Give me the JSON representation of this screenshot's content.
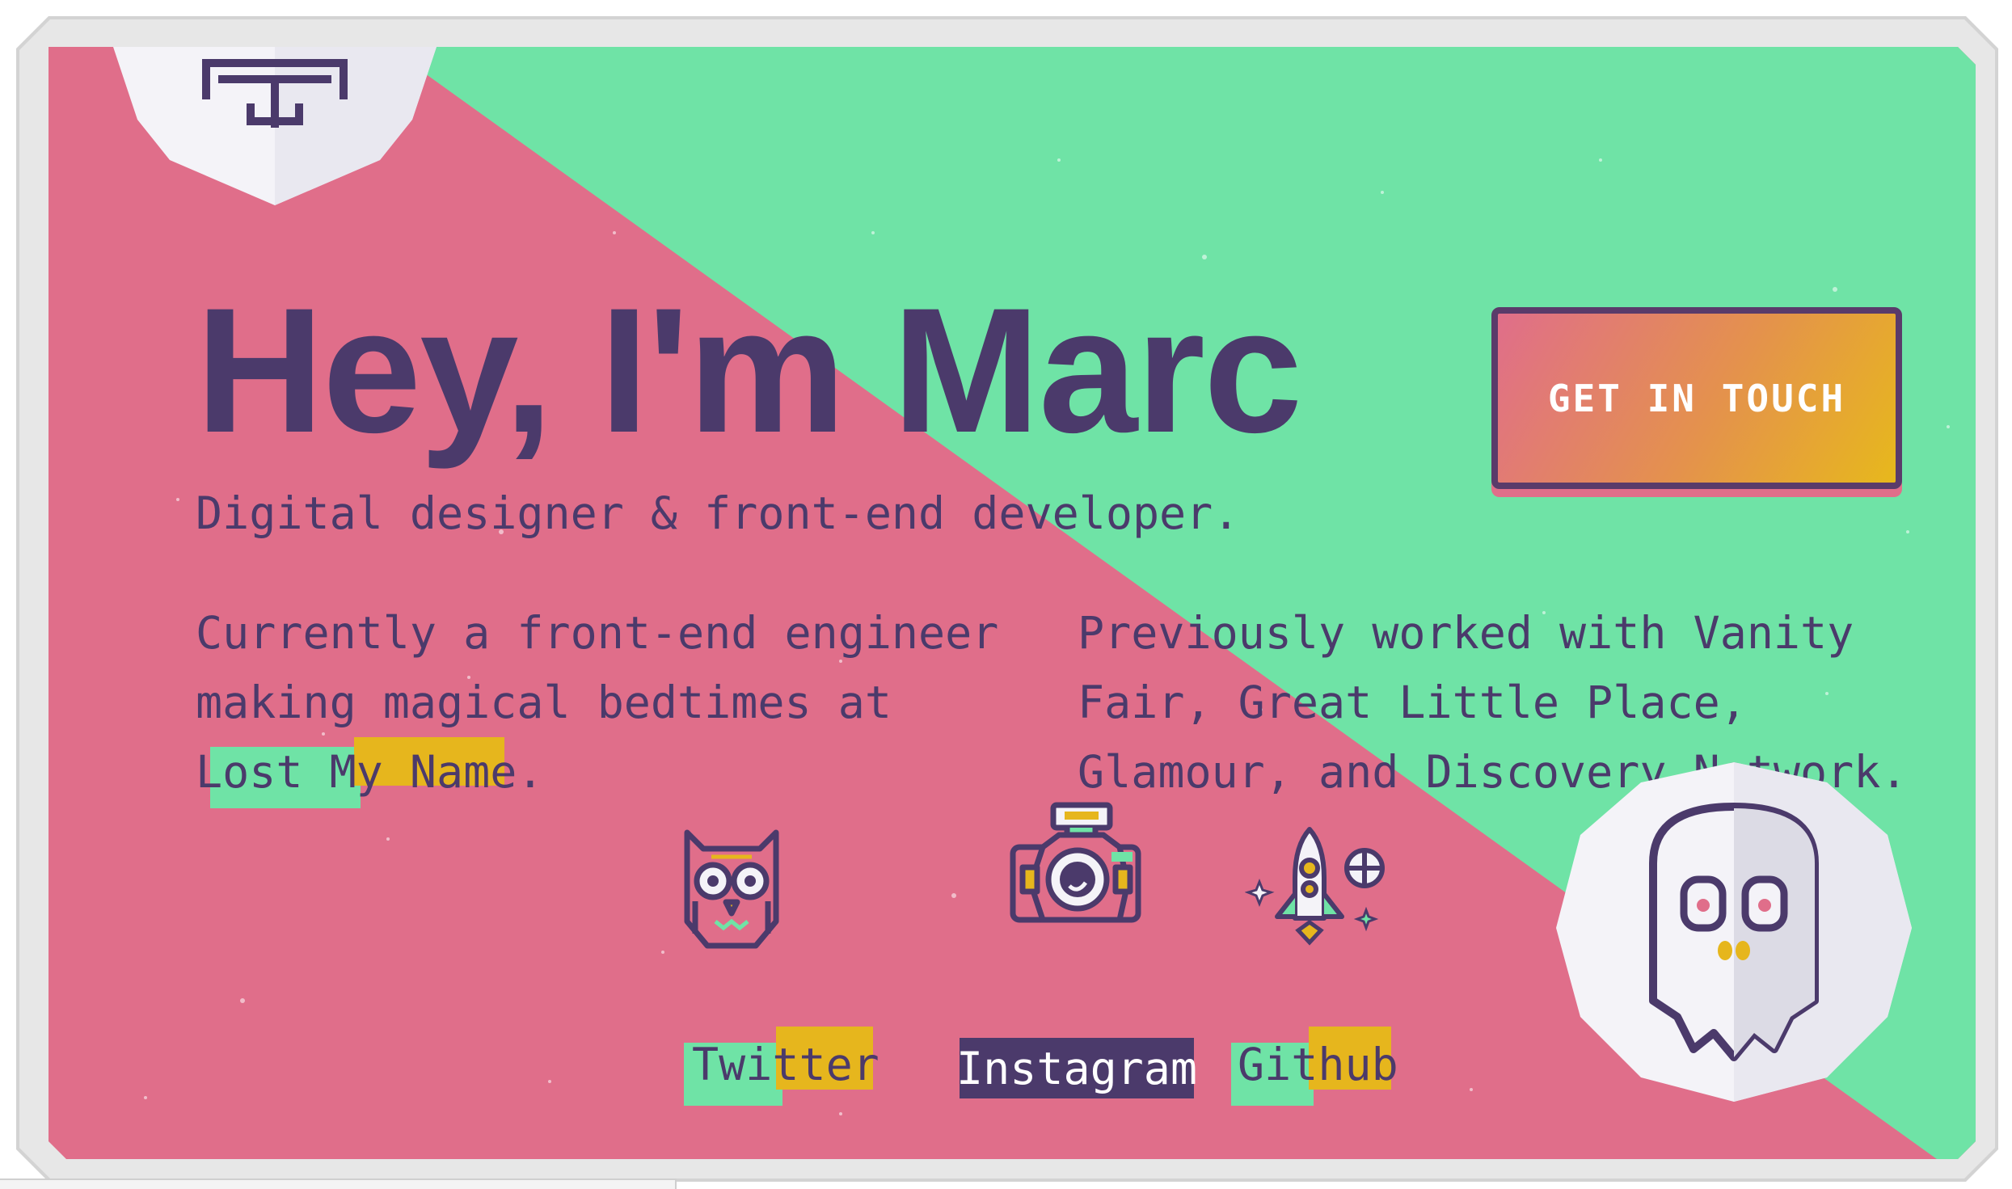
{
  "hero": {
    "headline": "Hey, I'm Marc",
    "subtitle": "Digital designer & front-end developer.",
    "current_before": "Currently a front-end engineer making magical bedtimes at ",
    "current_link": "Lost My Name",
    "current_after": ".",
    "previous": "Previously worked with Vanity Fair, Great Little Place, Glamour, and Discovery Network.",
    "cta_label": "GET IN TOUCH"
  },
  "social": {
    "twitter": "Twitter",
    "instagram": "Instagram",
    "github": "Github"
  },
  "colors": {
    "pink": "#e06e8a",
    "green": "#6fe3a6",
    "purple": "#4b3a6b",
    "gold": "#e6b61d",
    "white": "#f4f3f8"
  },
  "icons": [
    "logo-icon",
    "owl-icon",
    "camera-icon",
    "rocket-icon",
    "ghost-icon"
  ]
}
